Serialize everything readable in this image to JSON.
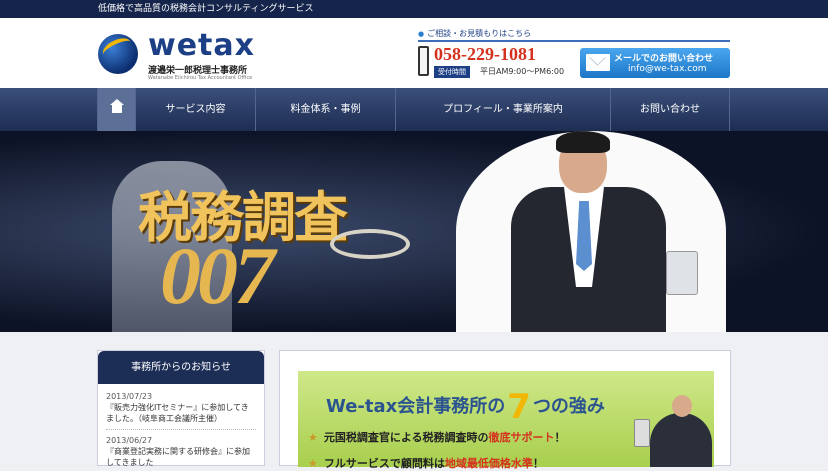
{
  "topbar": {
    "text": "低価格で高品質の税務会計コンサルティングサービス"
  },
  "logo": {
    "name": "wetax",
    "office_jp": "渡邉栄一郎税理士事務所",
    "office_en": "Watanabe Eiichirou Tax Accountant Office"
  },
  "contact": {
    "label": "ご相談・お見積もりはこちら",
    "phone": "058-229-1081",
    "hours_badge": "受付時間",
    "hours": "平日AM9:00〜PM6:00",
    "mail_title": "メールでのお問い合わせ",
    "mail_address": "info@we-tax.com"
  },
  "nav": {
    "items": [
      {
        "label": "サービス内容"
      },
      {
        "label": "料金体系・事例"
      },
      {
        "label": "プロフィール・事業所案内"
      },
      {
        "label": "お問い合わせ"
      }
    ]
  },
  "hero": {
    "title": "税務調査",
    "code": "007"
  },
  "news": {
    "heading": "事務所からのお知らせ",
    "items": [
      {
        "date": "2013/07/23",
        "text": "『販売力強化ITセミナー』に参加してきました。（岐阜商工会議所主催）"
      },
      {
        "date": "2013/06/27",
        "text": "『商業登記実務に関する研修会』に参加してきました"
      }
    ]
  },
  "strengths": {
    "title_prefix": "We-tax会計事務所の",
    "title_number": "7",
    "title_suffix": "つの強み",
    "line1_prefix": "元国税調査官による税務調査時の",
    "line1_highlight": "徹底サポート",
    "line1_suffix": "！",
    "line2_prefix": "フルサービスで顧問料は",
    "line2_highlight": "地域最低価格水準",
    "line2_suffix": "！"
  }
}
